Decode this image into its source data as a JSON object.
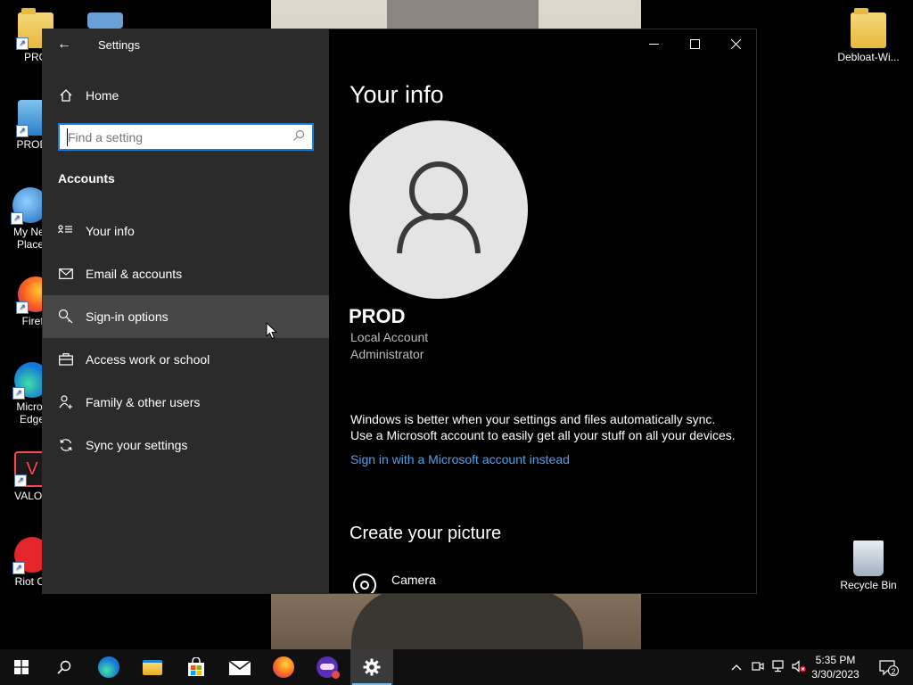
{
  "desktop": {
    "icons_left": [
      {
        "label": "PRO"
      },
      {
        "label": "PROD's"
      },
      {
        "label": "My Net",
        "label2": "Place"
      },
      {
        "label": "Firefo"
      },
      {
        "label": "Micros",
        "label2": "Edge"
      },
      {
        "label": "VALOR"
      },
      {
        "label": "Riot Cli"
      }
    ],
    "icons_right": [
      {
        "label": "Debloat-Wi..."
      },
      {
        "label": "Recycle Bin"
      }
    ]
  },
  "window": {
    "title": "Settings",
    "back_glyph": "←",
    "minimize_glyph": "—",
    "maximize_glyph": "☐",
    "close_glyph": "✕"
  },
  "sidebar": {
    "home_label": "Home",
    "search_placeholder": "Find a setting",
    "section_heading": "Accounts",
    "items": [
      {
        "label": "Your info",
        "icon": "person-list-icon"
      },
      {
        "label": "Email & accounts",
        "icon": "mail-icon"
      },
      {
        "label": "Sign-in options",
        "icon": "key-icon"
      },
      {
        "label": "Access work or school",
        "icon": "briefcase-icon"
      },
      {
        "label": "Family & other users",
        "icon": "person-add-icon"
      },
      {
        "label": "Sync your settings",
        "icon": "sync-icon"
      }
    ]
  },
  "content": {
    "page_title": "Your info",
    "user_name": "PROD",
    "account_type": "Local Account",
    "account_role": "Administrator",
    "sync_line1": "Windows is better when your settings and files automatically sync.",
    "sync_line2": "Use a Microsoft account to easily get all your stuff on all your devices.",
    "ms_link": "Sign in with a Microsoft account instead",
    "create_heading": "Create your picture",
    "camera_label": "Camera"
  },
  "taskbar": {
    "time": "5:35 PM",
    "date": "3/30/2023",
    "notification_count": "2"
  },
  "colors": {
    "accent": "#1f7bd8",
    "link": "#4ea2ee",
    "sidebar_bg": "#2b2b2b",
    "hover_bg": "#474747"
  }
}
